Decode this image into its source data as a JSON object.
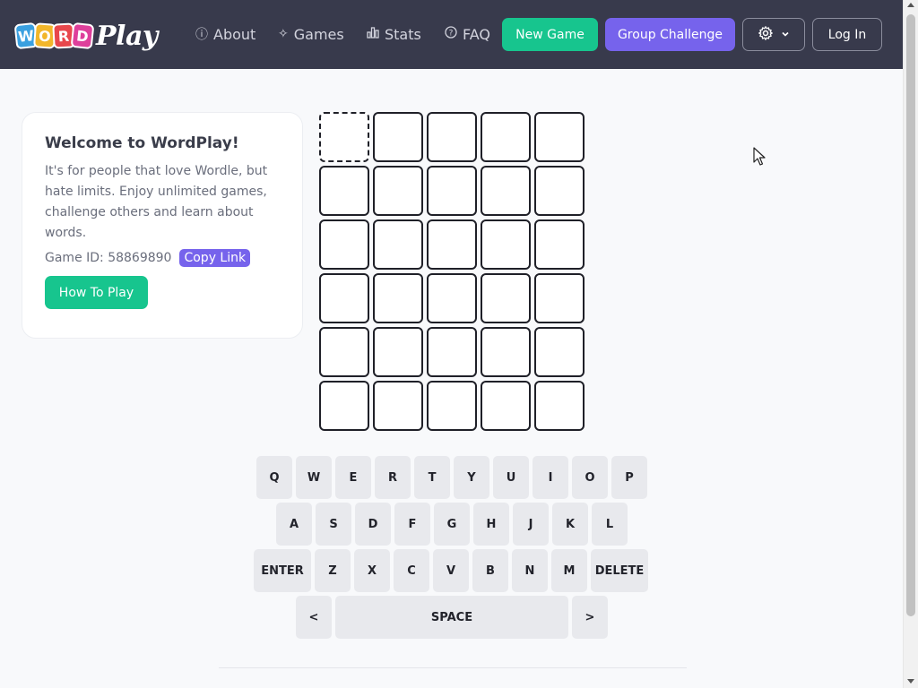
{
  "header": {
    "logo": {
      "tiles": [
        "W",
        "O",
        "R",
        "D"
      ],
      "play": "Play"
    },
    "nav": [
      {
        "label": "About",
        "icon": "info-circle-icon"
      },
      {
        "label": "Games",
        "icon": "puzzle-icon"
      },
      {
        "label": "Stats",
        "icon": "bar-chart-icon"
      },
      {
        "label": "FAQ",
        "icon": "question-circle-icon"
      }
    ],
    "new_game": "New Game",
    "group_challenge": "Group Challenge",
    "settings_icon": "gear-icon",
    "login": "Log In"
  },
  "colors": {
    "header_bg": "#383a4c",
    "green": "#17c58e",
    "purple": "#7663ec"
  },
  "welcome": {
    "title": "Welcome to WordPlay!",
    "body": "It's for people that love Wordle, but hate limits. Enjoy unlimited games, challenge others and learn about words.",
    "game_id_label": "Game ID: 58869890",
    "copy_link": "Copy Link",
    "how_to_play": "How To Play"
  },
  "board": {
    "rows": 6,
    "cols": 5,
    "active_row": 0,
    "active_col": 0
  },
  "keyboard": {
    "row1": [
      "Q",
      "W",
      "E",
      "R",
      "T",
      "Y",
      "U",
      "I",
      "O",
      "P"
    ],
    "row2": [
      "A",
      "S",
      "D",
      "F",
      "G",
      "H",
      "J",
      "K",
      "L"
    ],
    "row3": [
      "ENTER",
      "Z",
      "X",
      "C",
      "V",
      "B",
      "N",
      "M",
      "DELETE"
    ],
    "row4": [
      "<",
      "SPACE",
      ">"
    ]
  }
}
